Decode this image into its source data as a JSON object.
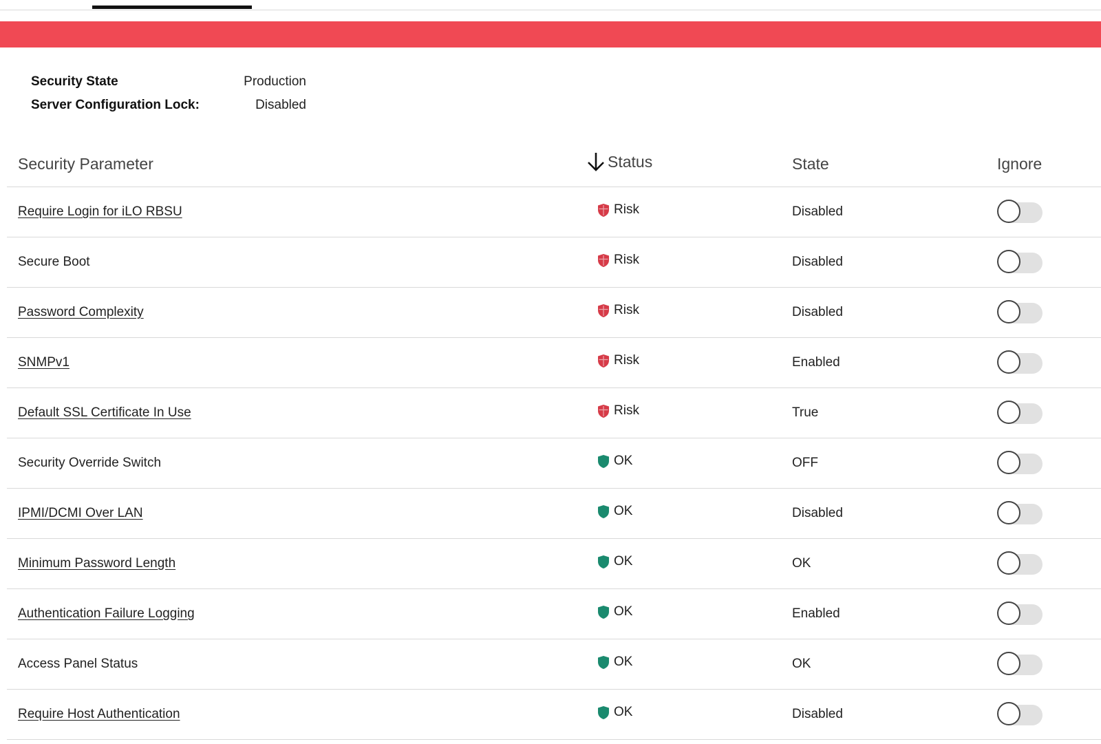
{
  "colors": {
    "banner": "#f04954",
    "risk": "#d63b48",
    "ok": "#1a8a6e"
  },
  "summary": [
    {
      "label": "Security State",
      "value": "Production"
    },
    {
      "label": "Server Configuration Lock:",
      "value": "Disabled"
    }
  ],
  "table": {
    "headers": {
      "param": "Security Parameter",
      "status": "Status",
      "state": "State",
      "ignore": "Ignore"
    },
    "sort_icon": "arrow-down-icon",
    "rows": [
      {
        "param": "Require Login for iLO RBSU",
        "link": true,
        "status": "Risk",
        "icon": "risk-shield-icon",
        "state": "Disabled",
        "ignore": false
      },
      {
        "param": "Secure Boot",
        "link": false,
        "status": "Risk",
        "icon": "risk-shield-icon",
        "state": "Disabled",
        "ignore": false
      },
      {
        "param": "Password Complexity",
        "link": true,
        "status": "Risk",
        "icon": "risk-shield-icon",
        "state": "Disabled",
        "ignore": false
      },
      {
        "param": "SNMPv1",
        "link": true,
        "status": "Risk",
        "icon": "risk-shield-icon",
        "state": "Enabled",
        "ignore": false
      },
      {
        "param": "Default SSL Certificate In Use",
        "link": true,
        "status": "Risk",
        "icon": "risk-shield-icon",
        "state": "True",
        "ignore": false
      },
      {
        "param": "Security Override Switch",
        "link": false,
        "status": "OK",
        "icon": "ok-shield-icon",
        "state": "OFF",
        "ignore": false
      },
      {
        "param": "IPMI/DCMI Over LAN",
        "link": true,
        "status": "OK",
        "icon": "ok-shield-icon",
        "state": "Disabled",
        "ignore": false
      },
      {
        "param": "Minimum Password Length",
        "link": true,
        "status": "OK",
        "icon": "ok-shield-icon",
        "state": "OK",
        "ignore": false
      },
      {
        "param": "Authentication Failure Logging",
        "link": true,
        "status": "OK",
        "icon": "ok-shield-icon",
        "state": "Enabled",
        "ignore": false
      },
      {
        "param": "Access Panel Status",
        "link": false,
        "status": "OK",
        "icon": "ok-shield-icon",
        "state": "OK",
        "ignore": false
      },
      {
        "param": "Require Host Authentication",
        "link": true,
        "status": "OK",
        "icon": "ok-shield-icon",
        "state": "Disabled",
        "ignore": false
      }
    ]
  }
}
